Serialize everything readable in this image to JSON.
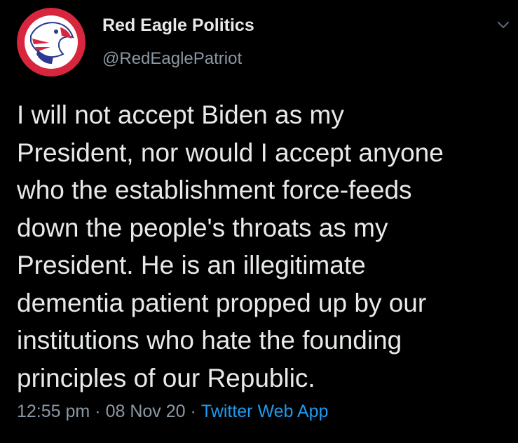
{
  "author": {
    "display_name": "Red Eagle Politics",
    "handle": "@RedEaglePatriot",
    "avatar_icon": "eagle-logo-icon"
  },
  "menu": {
    "icon": "chevron-down-icon"
  },
  "tweet": {
    "text": "I will not accept Biden as my\nPresident, nor would I accept anyone\nwho the establishment force-feeds\ndown the people's throats as my\nPresident. He is an illegitimate\ndementia patient propped up by our\ninstitutions who hate the founding\nprinciples of our Republic.",
    "time": "12:55 pm",
    "separator": "·",
    "date": "08 Nov 20",
    "source": "Twitter Web App"
  },
  "colors": {
    "background": "#000000",
    "text": "#e7e9ea",
    "muted": "#8b98a5",
    "link": "#1d9bf0",
    "avatar_red": "#d7263d",
    "avatar_blue": "#2b3990"
  }
}
